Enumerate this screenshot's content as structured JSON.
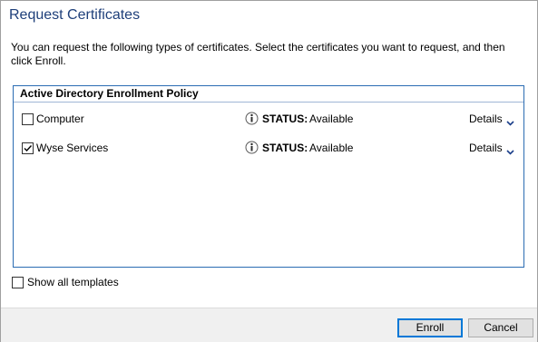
{
  "dialog": {
    "title": "Request Certificates",
    "description": "You can request the following types of certificates. Select the certificates you want to request, and then click Enroll."
  },
  "policy": {
    "header": "Active Directory Enrollment Policy",
    "items": [
      {
        "name": "Computer",
        "checked": false,
        "status_label": "STATUS:",
        "status_value": "Available",
        "details_label": "Details"
      },
      {
        "name": "Wyse Services",
        "checked": true,
        "status_label": "STATUS:",
        "status_value": "Available",
        "details_label": "Details"
      }
    ]
  },
  "show_all": {
    "label": "Show all templates",
    "checked": false
  },
  "buttons": {
    "enroll": "Enroll",
    "cancel": "Cancel"
  },
  "colors": {
    "title": "#1e3f7a",
    "policy_border": "#2b6cb3",
    "primary_border": "#0078d7",
    "footer_bg": "#f0f0f0"
  },
  "icons": {
    "info": "info-icon",
    "chevron": "chevron-down-icon",
    "check": "checkmark-icon"
  }
}
